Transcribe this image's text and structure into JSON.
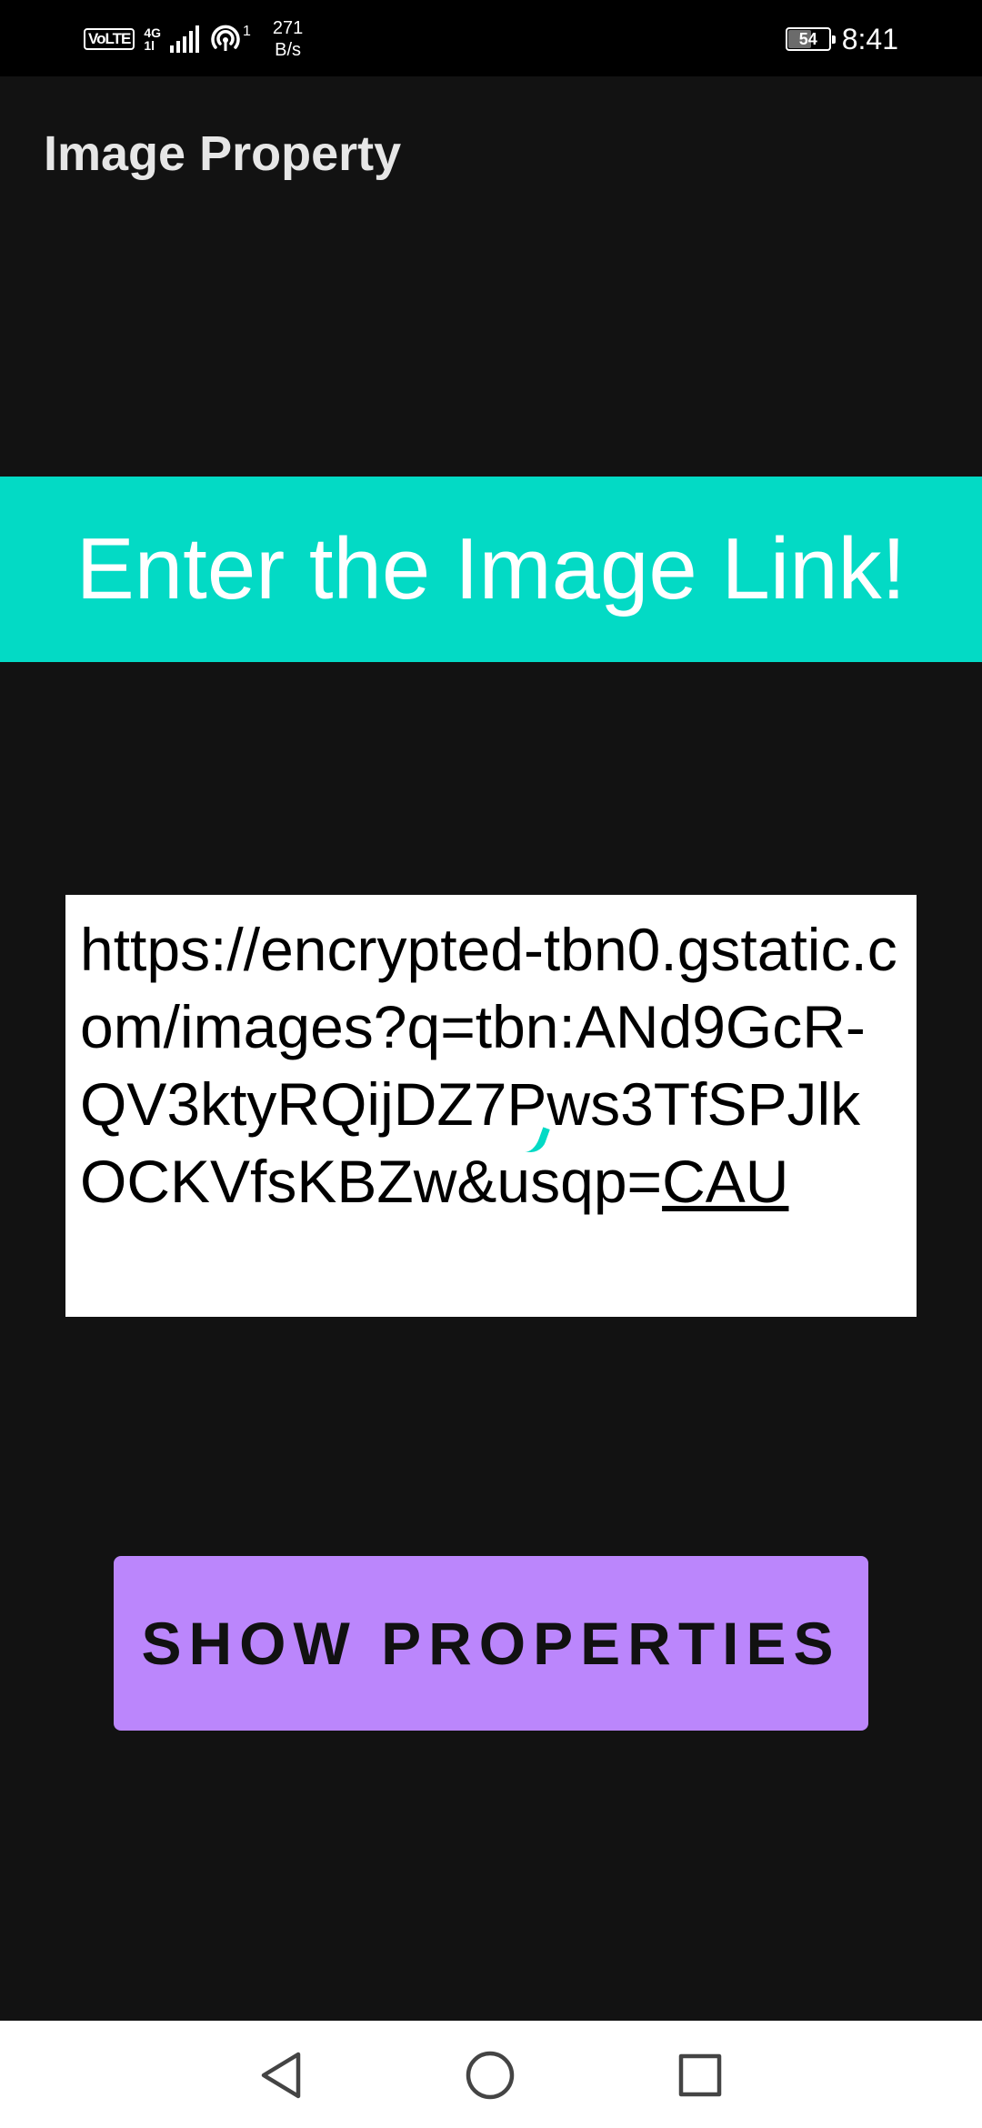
{
  "status_bar": {
    "volte": "VoLTE",
    "network_type_top": "4G",
    "network_type_bottom": "1l",
    "hotspot_superscript": "1",
    "speed_value": "271",
    "speed_unit": "B/s",
    "battery_level": "54",
    "time": "8:41"
  },
  "app_bar": {
    "title": "Image Property"
  },
  "banner": {
    "text": "Enter the Image Link!",
    "color": "#03dac5"
  },
  "url_input": {
    "value_main": "https://encrypted-tbn0.gstatic.com/images?q=tbn:ANd9GcR-QV3ktyRQijDZ7Pws3TfSPJlkOCKVfsKBZw&usqp=",
    "value_underlined": "CAU"
  },
  "action_button": {
    "label": "SHOW PROPERTIES",
    "color": "#bb86fc"
  },
  "nav_bar": {
    "back_icon": "back-triangle-icon",
    "home_icon": "home-circle-icon",
    "recents_icon": "recents-square-icon"
  }
}
